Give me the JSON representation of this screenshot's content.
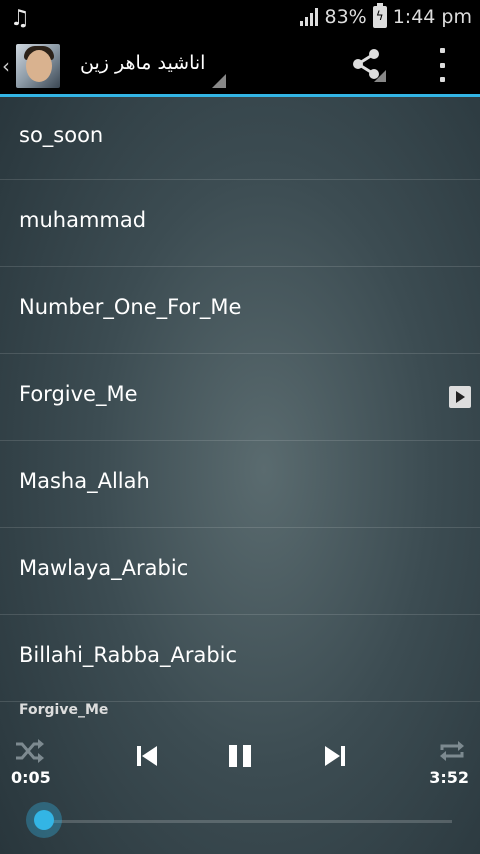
{
  "status": {
    "battery": "83%",
    "time": "1:44 pm"
  },
  "actionbar": {
    "title": "اناشيد ماهر زين"
  },
  "songs": [
    {
      "title": "so_soon"
    },
    {
      "title": "muhammad"
    },
    {
      "title": "Number_One_For_Me"
    },
    {
      "title": "Forgive_Me",
      "playing": true
    },
    {
      "title": "Masha_Allah"
    },
    {
      "title": "Mawlaya_Arabic"
    },
    {
      "title": "Billahi_Rabba_Arabic"
    }
  ],
  "player": {
    "now_playing": "Forgive_Me",
    "current_time": "0:05",
    "total_time": "3:52",
    "progress_fraction": 0.02
  },
  "colors": {
    "accent": "#33b5e5",
    "bar_bg": "#000000"
  }
}
